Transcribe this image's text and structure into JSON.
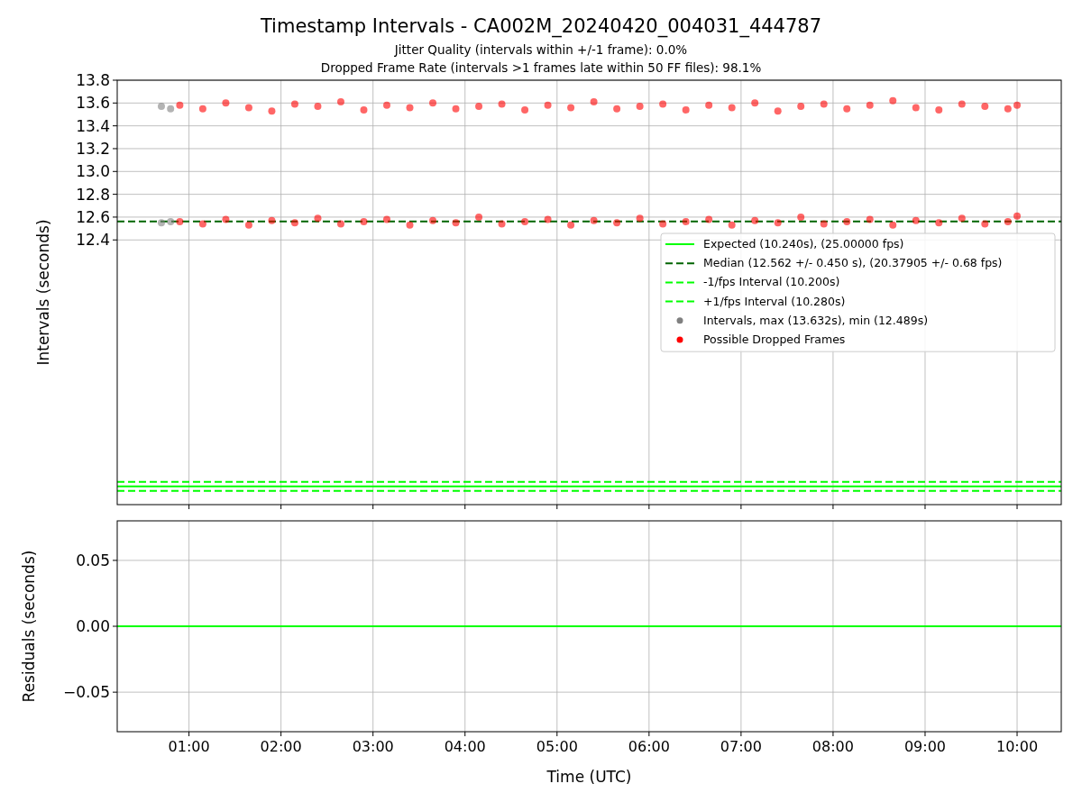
{
  "figure": {
    "title": "Timestamp Intervals - CA002M_20240420_004031_444787",
    "subtitles": [
      "Jitter Quality (intervals within +/-1 frame): 0.0%",
      "Dropped Frame Rate (intervals >1 frames late within 50 FF files): 98.1%"
    ]
  },
  "intervals_panel": {
    "chart_data": {
      "type": "scatter",
      "ylabel": "Intervals (seconds)",
      "xlim": [
        0.22,
        10.48
      ],
      "ylim": [
        10.08,
        13.8
      ],
      "grid": true,
      "yticks": [
        {
          "value": 12.4,
          "label": "12.4"
        },
        {
          "value": 12.6,
          "label": "12.6"
        },
        {
          "value": 12.8,
          "label": "12.8"
        },
        {
          "value": 13.0,
          "label": "13.0"
        },
        {
          "value": 13.2,
          "label": "13.2"
        },
        {
          "value": 13.4,
          "label": "13.4"
        },
        {
          "value": 13.6,
          "label": "13.6"
        },
        {
          "value": 13.8,
          "label": "13.8"
        }
      ],
      "x": [
        0.7,
        0.8,
        0.9,
        1.15,
        1.4,
        1.65,
        1.9,
        2.15,
        2.4,
        2.65,
        2.9,
        3.15,
        3.4,
        3.65,
        3.9,
        4.15,
        4.4,
        4.65,
        4.9,
        5.15,
        5.4,
        5.65,
        5.9,
        6.15,
        6.4,
        6.65,
        6.9,
        7.15,
        7.4,
        7.65,
        7.9,
        8.15,
        8.4,
        8.65,
        8.9,
        9.15,
        9.4,
        9.65,
        9.9,
        10.0,
        0.7,
        0.8,
        0.9,
        1.15,
        1.4,
        1.65,
        1.9,
        2.15,
        2.4,
        2.65,
        2.9,
        3.15,
        3.4,
        3.65,
        3.9,
        4.15,
        4.4,
        4.65,
        4.9,
        5.15,
        5.4,
        5.65,
        5.9,
        6.15,
        6.4,
        6.65,
        6.9,
        7.15,
        7.4,
        7.65,
        7.9,
        8.15,
        8.4,
        8.65,
        8.9,
        9.15,
        9.4,
        9.65,
        9.9,
        10.0
      ],
      "legend": true,
      "ref_lines": [
        {
          "axis": "y",
          "value": 10.24,
          "label": "Expected (10.240s), (25.00000 fps)",
          "color": "#00ff00"
        },
        {
          "axis": "y",
          "value": 12.562,
          "label": "Median (12.562 +/- 0.450 s), (20.37905 +/- 0.68 fps)",
          "color": "#006400"
        },
        {
          "axis": "y",
          "value": 10.2,
          "label": "-1/fps Interval (10.200s)",
          "color": "#00ff00"
        },
        {
          "axis": "y",
          "value": 10.28,
          "label": "+1/fps Interval (10.280s)",
          "color": "#00ff00"
        }
      ],
      "series": [
        {
          "name": "Intervals, max (13.632s), min (12.489s)",
          "color": "#808080",
          "values": [
            13.57,
            13.55,
            null,
            null,
            null,
            null,
            null,
            null,
            null,
            null,
            null,
            null,
            null,
            null,
            null,
            null,
            null,
            null,
            null,
            null,
            null,
            null,
            null,
            null,
            null,
            null,
            null,
            null,
            null,
            null,
            null,
            null,
            null,
            null,
            null,
            null,
            null,
            null,
            null,
            null,
            12.55,
            12.56,
            null,
            null,
            null,
            null,
            null,
            null,
            null,
            null,
            null,
            null,
            null,
            null,
            null,
            null,
            null,
            null,
            null,
            null,
            null,
            null,
            null,
            null,
            null,
            null,
            null,
            null,
            null,
            null,
            null,
            null,
            null,
            null,
            null,
            null,
            null,
            null,
            null,
            null
          ]
        },
        {
          "name": "Possible Dropped Frames",
          "color": "#ff0000",
          "values": [
            null,
            null,
            13.58,
            13.55,
            13.6,
            13.56,
            13.53,
            13.59,
            13.57,
            13.61,
            13.54,
            13.58,
            13.56,
            13.6,
            13.55,
            13.57,
            13.59,
            13.54,
            13.58,
            13.56,
            13.61,
            13.55,
            13.57,
            13.59,
            13.54,
            13.58,
            13.56,
            13.6,
            13.53,
            13.57,
            13.59,
            13.55,
            13.58,
            13.62,
            13.56,
            13.54,
            13.59,
            13.57,
            13.55,
            13.58,
            null,
            null,
            12.56,
            12.54,
            12.58,
            12.53,
            12.57,
            12.55,
            12.59,
            12.54,
            12.56,
            12.58,
            12.53,
            12.57,
            12.55,
            12.6,
            12.54,
            12.56,
            12.58,
            12.53,
            12.57,
            12.55,
            12.59,
            12.54,
            12.56,
            12.58,
            12.53,
            12.57,
            12.55,
            12.6,
            12.54,
            12.56,
            12.58,
            12.53,
            12.57,
            12.55,
            12.59,
            12.54,
            12.56,
            12.61
          ]
        }
      ]
    }
  },
  "residuals_panel": {
    "chart_data": {
      "type": "line",
      "grid": true,
      "xlabel": "Time (UTC)",
      "ylabel": "Residuals (seconds)",
      "xlim": [
        0.22,
        10.48
      ],
      "ylim": [
        -0.08,
        0.08
      ],
      "xticks": [
        {
          "value": 1,
          "label": "01:00"
        },
        {
          "value": 2,
          "label": "02:00"
        },
        {
          "value": 3,
          "label": "03:00"
        },
        {
          "value": 4,
          "label": "04:00"
        },
        {
          "value": 5,
          "label": "05:00"
        },
        {
          "value": 6,
          "label": "06:00"
        },
        {
          "value": 7,
          "label": "07:00"
        },
        {
          "value": 8,
          "label": "08:00"
        },
        {
          "value": 9,
          "label": "09:00"
        },
        {
          "value": 10,
          "label": "10:00"
        }
      ],
      "yticks": [
        {
          "value": -0.05,
          "label": "−0.05"
        },
        {
          "value": 0,
          "label": "0.00"
        },
        {
          "value": 0.05,
          "label": "0.05"
        }
      ],
      "x": [
        0.22,
        10.48
      ],
      "series": [
        {
          "color": "#00ff00",
          "values": [
            0,
            0
          ]
        }
      ]
    }
  }
}
